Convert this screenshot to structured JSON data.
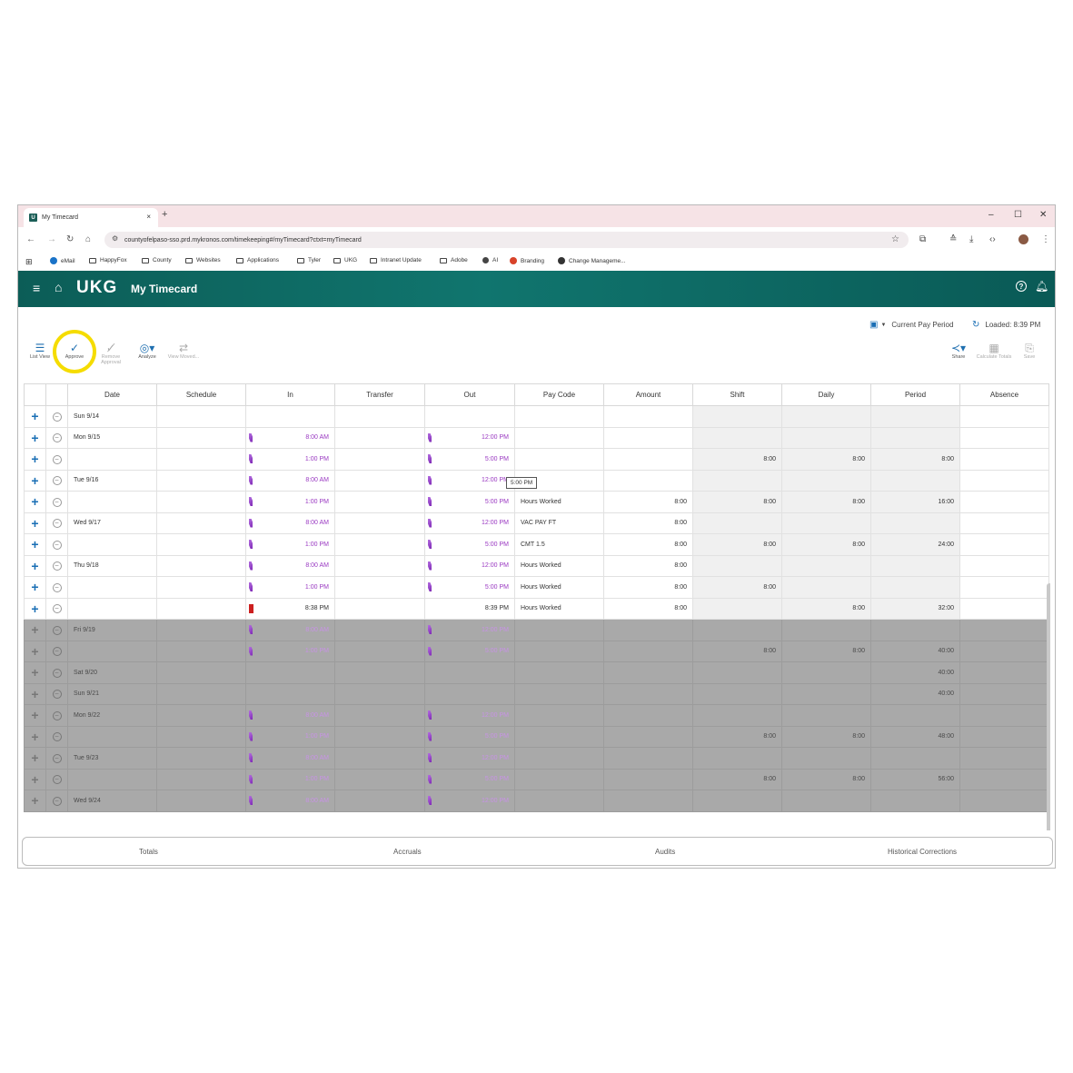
{
  "browser": {
    "tab_title": "My Timecard",
    "tab_favicon": "U",
    "tab_close": "×",
    "new_tab": "+",
    "window_controls": [
      "–",
      "☐",
      "✕"
    ],
    "url": "countyofelpaso-sso.prd.mykronos.com/timekeeping#/myTimecard?ctxt=myTimecard",
    "bookmarks": [
      "eMail",
      "HappyFox",
      "County",
      "Websites",
      "Applications",
      "Tyler",
      "UKG",
      "Intranet Update",
      "Adobe",
      "AI",
      "Branding",
      "Change Manageme..."
    ]
  },
  "app": {
    "logo": "UKG",
    "title": "My Timecard",
    "pay_period": "Current Pay Period",
    "loaded": "Loaded: 8:39 PM"
  },
  "toolbar": {
    "list_view": "List View",
    "approve": "Approve",
    "remove_approval": "Remove Approval",
    "analyze": "Analyze",
    "view_moved": "View Moved...",
    "share": "Share",
    "calculate_totals": "Calculate Totals",
    "save": "Save"
  },
  "columns": [
    "Date",
    "Schedule",
    "In",
    "Transfer",
    "Out",
    "Pay Code",
    "Amount",
    "Shift",
    "Daily",
    "Period",
    "Absence"
  ],
  "rows": [
    {
      "date": "Sun 9/14",
      "in": "",
      "out": "",
      "paycode": "",
      "amount": "",
      "shift": "",
      "daily": "",
      "period": "",
      "dark": false
    },
    {
      "date": "Mon 9/15",
      "in": "8:00 AM",
      "out": "12:00 PM",
      "paycode": "",
      "amount": "",
      "shift": "",
      "daily": "",
      "period": "",
      "dark": false
    },
    {
      "date": "",
      "in": "1:00 PM",
      "out": "5:00 PM",
      "paycode": "",
      "amount": "",
      "shift": "8:00",
      "daily": "8:00",
      "period": "8:00",
      "dark": false
    },
    {
      "date": "Tue 9/16",
      "in": "8:00 AM",
      "out": "12:00 PM",
      "paycode": "",
      "amount": "",
      "shift": "",
      "daily": "",
      "period": "",
      "dark": false
    },
    {
      "date": "",
      "in": "1:00 PM",
      "out": "5:00 PM",
      "paycode": "Hours Worked",
      "amount": "8:00",
      "shift": "8:00",
      "daily": "8:00",
      "period": "16:00",
      "dark": false
    },
    {
      "date": "Wed 9/17",
      "in": "8:00 AM",
      "out": "12:00 PM",
      "paycode": "VAC PAY FT",
      "amount": "8:00",
      "shift": "",
      "daily": "",
      "period": "",
      "dark": false
    },
    {
      "date": "",
      "in": "1:00 PM",
      "out": "5:00 PM",
      "paycode": "CMT 1.5",
      "amount": "8:00",
      "shift": "8:00",
      "daily": "8:00",
      "period": "24:00",
      "dark": false
    },
    {
      "date": "Thu 9/18",
      "in": "8:00 AM",
      "out": "12:00 PM",
      "paycode": "Hours Worked",
      "amount": "8:00",
      "shift": "",
      "daily": "",
      "period": "",
      "dark": false
    },
    {
      "date": "",
      "in": "1:00 PM",
      "out": "5:00 PM",
      "paycode": "Hours Worked",
      "amount": "8:00",
      "shift": "8:00",
      "daily": "",
      "period": "",
      "dark": false
    },
    {
      "date": "",
      "in": "8:38 PM",
      "out": "8:39 PM",
      "paycode": "Hours Worked",
      "amount": "8:00",
      "shift": "",
      "daily": "8:00",
      "period": "32:00",
      "dark": false,
      "special": true
    },
    {
      "date": "Fri 9/19",
      "in": "8:00 AM",
      "out": "12:00 PM",
      "paycode": "",
      "amount": "",
      "shift": "",
      "daily": "",
      "period": "",
      "dark": true
    },
    {
      "date": "",
      "in": "1:00 PM",
      "out": "5:00 PM",
      "paycode": "",
      "amount": "",
      "shift": "8:00",
      "daily": "8:00",
      "period": "40:00",
      "dark": true
    },
    {
      "date": "Sat 9/20",
      "in": "",
      "out": "",
      "paycode": "",
      "amount": "",
      "shift": "",
      "daily": "",
      "period": "40:00",
      "dark": true
    },
    {
      "date": "Sun 9/21",
      "in": "",
      "out": "",
      "paycode": "",
      "amount": "",
      "shift": "",
      "daily": "",
      "period": "40:00",
      "dark": true
    },
    {
      "date": "Mon 9/22",
      "in": "8:00 AM",
      "out": "12:00 PM",
      "paycode": "",
      "amount": "",
      "shift": "",
      "daily": "",
      "period": "",
      "dark": true
    },
    {
      "date": "",
      "in": "1:00 PM",
      "out": "5:00 PM",
      "paycode": "",
      "amount": "",
      "shift": "8:00",
      "daily": "8:00",
      "period": "48:00",
      "dark": true
    },
    {
      "date": "Tue 9/23",
      "in": "8:00 AM",
      "out": "12:00 PM",
      "paycode": "",
      "amount": "",
      "shift": "",
      "daily": "",
      "period": "",
      "dark": true
    },
    {
      "date": "",
      "in": "1:00 PM",
      "out": "5:00 PM",
      "paycode": "",
      "amount": "",
      "shift": "8:00",
      "daily": "8:00",
      "period": "56:00",
      "dark": true
    },
    {
      "date": "Wed 9/24",
      "in": "8:00 AM",
      "out": "12:00 PM",
      "paycode": "",
      "amount": "",
      "shift": "",
      "daily": "",
      "period": "",
      "dark": true
    }
  ],
  "tooltip": "5:00 PM",
  "bottom_tabs": [
    "Totals",
    "Accruals",
    "Audits",
    "Historical Corrections"
  ],
  "colors": {
    "header_teal": "#10756e",
    "accent_blue": "#1a6fb5",
    "punch_purple": "#9a39c2",
    "highlight": "#f5dc00"
  }
}
